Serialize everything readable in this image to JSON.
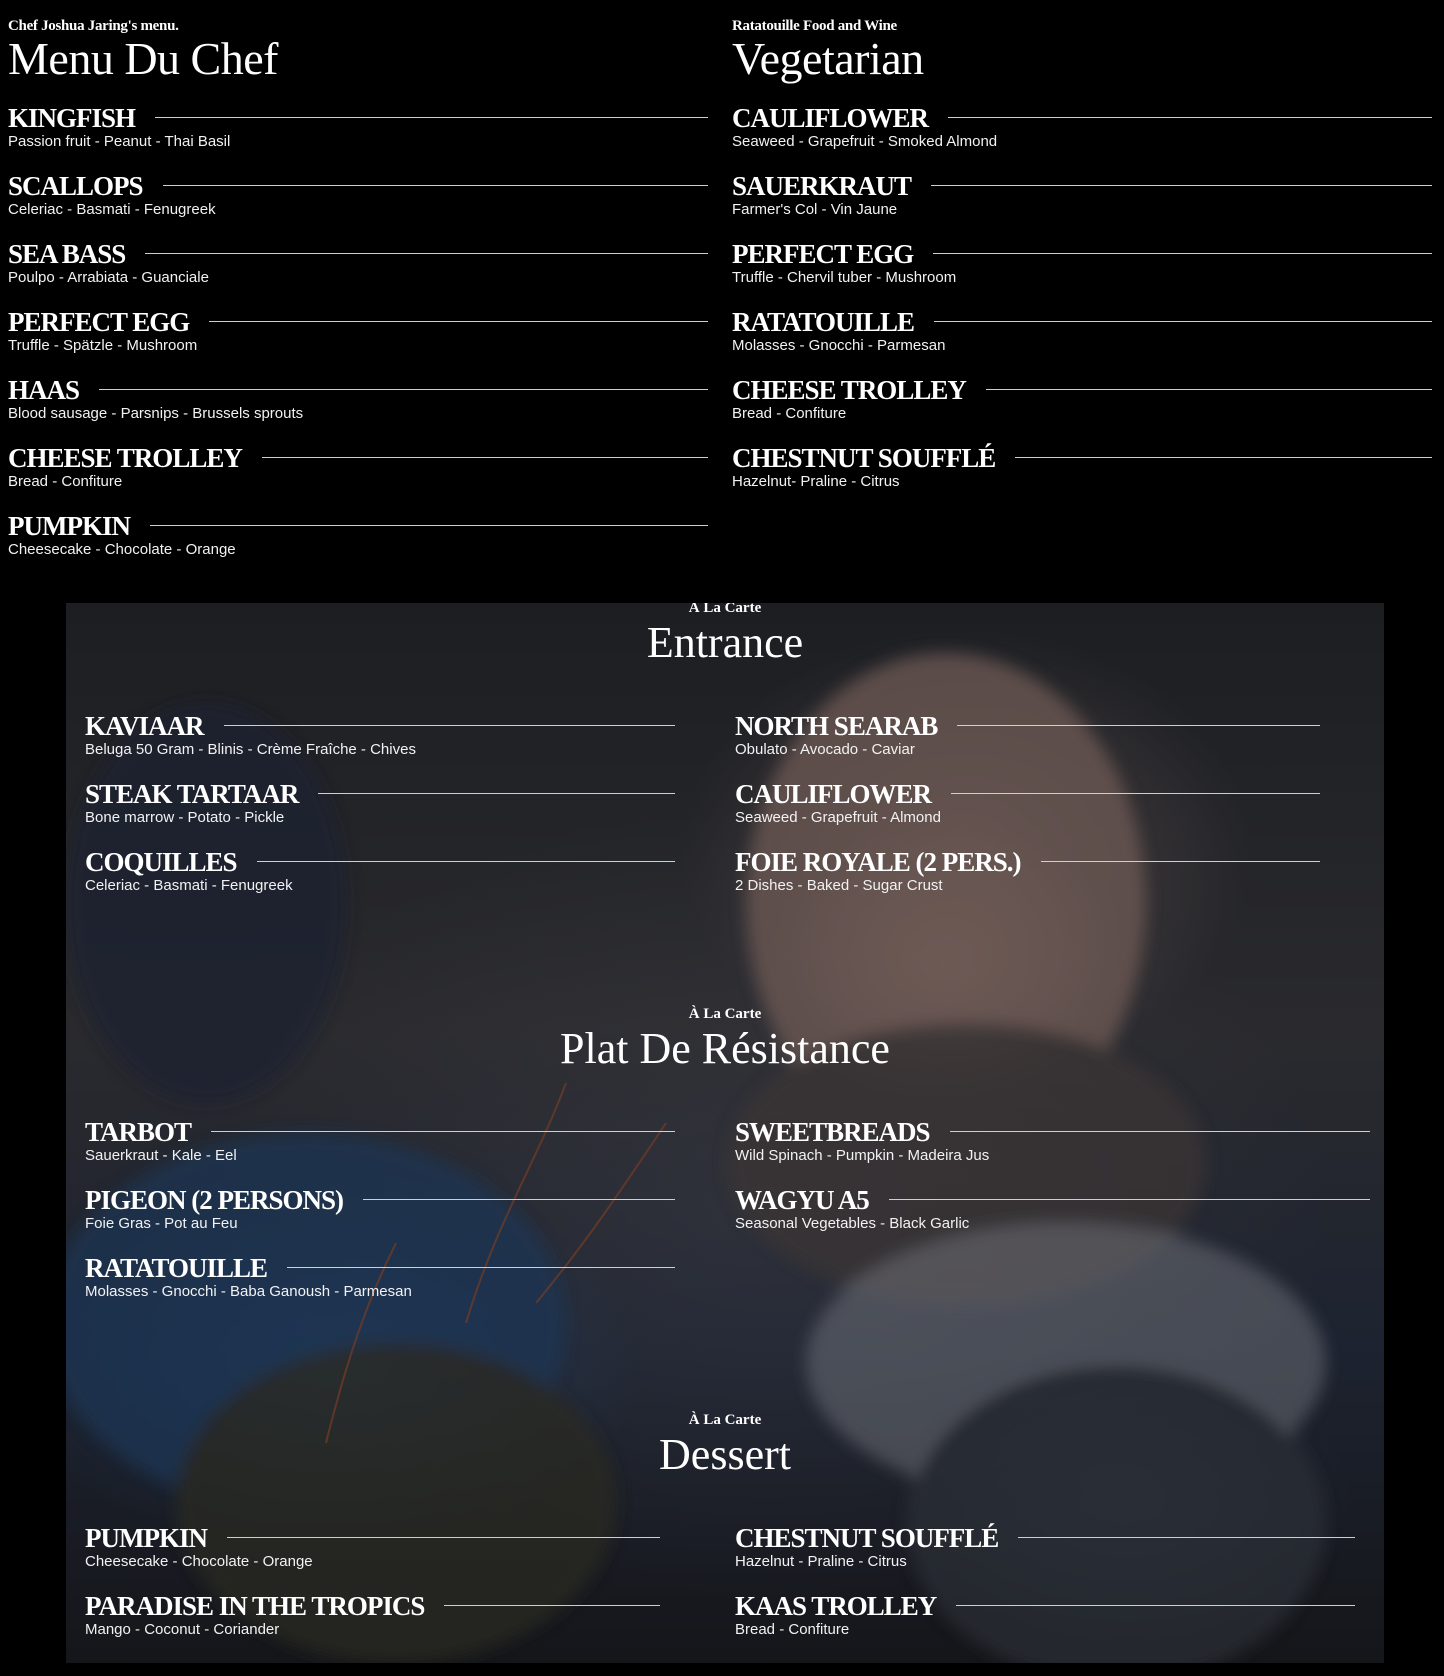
{
  "chef_menu": {
    "eyebrow": "Chef Joshua Jaring's menu.",
    "title": "Menu Du Chef",
    "items": [
      {
        "name": "KINGFISH",
        "desc": "Passion fruit - Peanut - Thai Basil"
      },
      {
        "name": "SCALLOPS",
        "desc": "Celeriac - Basmati - Fenugreek"
      },
      {
        "name": "SEA BASS",
        "desc": "Poulpo - Arrabiata - Guanciale"
      },
      {
        "name": "PERFECT EGG",
        "desc": "Truffle - Spätzle - Mushroom"
      },
      {
        "name": "HAAS",
        "desc": "Blood sausage - Parsnips - Brussels sprouts"
      },
      {
        "name": "CHEESE TROLLEY",
        "desc": "Bread - Confiture"
      },
      {
        "name": "PUMPKIN",
        "desc": "Cheesecake - Chocolate - Orange"
      }
    ]
  },
  "vegetarian_menu": {
    "eyebrow": "Ratatouille Food and Wine",
    "title": "Vegetarian",
    "items": [
      {
        "name": "CAULIFLOWER",
        "desc": "Seaweed - Grapefruit - Smoked Almond"
      },
      {
        "name": "SAUERKRAUT",
        "desc": "Farmer's Col - Vin Jaune"
      },
      {
        "name": "PERFECT EGG",
        "desc": "Truffle - Chervil tuber - Mushroom"
      },
      {
        "name": "RATATOUILLE",
        "desc": "Molasses - Gnocchi - Parmesan"
      },
      {
        "name": "CHEESE TROLLEY",
        "desc": "Bread - Confiture"
      },
      {
        "name": "CHESTNUT SOUFFLÉ",
        "desc": "Hazelnut- Praline - Citrus"
      }
    ]
  },
  "entrance": {
    "eyebrow": "À La Carte",
    "title": "Entrance",
    "left": [
      {
        "name": "KAVIAAR",
        "desc": "Beluga 50 Gram - Blinis - Crème Fraîche - Chives"
      },
      {
        "name": "STEAK TARTAAR",
        "desc": "Bone marrow - Potato - Pickle"
      },
      {
        "name": "COQUILLES",
        "desc": "Celeriac - Basmati - Fenugreek"
      }
    ],
    "right": [
      {
        "name": "NORTH SEARAB",
        "desc": "Obulato - Avocado - Caviar"
      },
      {
        "name": "CAULIFLOWER",
        "desc": "Seaweed - Grapefruit - Almond"
      },
      {
        "name": "FOIE ROYALE (2 PERS.)",
        "desc": "2 Dishes - Baked - Sugar Crust"
      }
    ]
  },
  "plat": {
    "eyebrow": "À La Carte",
    "title": "Plat De Résistance",
    "left": [
      {
        "name": "TARBOT",
        "desc": "Sauerkraut - Kale - Eel"
      },
      {
        "name": "PIGEON (2 PERSONS)",
        "desc": "Foie Gras - Pot au Feu"
      },
      {
        "name": "RATATOUILLE",
        "desc": "Molasses - Gnocchi - Baba Ganoush - Parmesan"
      }
    ],
    "right": [
      {
        "name": "SWEETBREADS",
        "desc": "Wild Spinach - Pumpkin - Madeira Jus"
      },
      {
        "name": "WAGYU A5",
        "desc": "Seasonal Vegetables - Black Garlic"
      }
    ]
  },
  "dessert": {
    "eyebrow": "À La Carte",
    "title": "Dessert",
    "left": [
      {
        "name": "PUMPKIN",
        "desc": "Cheesecake - Chocolate - Orange"
      },
      {
        "name": "PARADISE IN THE TROPICS",
        "desc": "Mango - Coconut - Coriander"
      }
    ],
    "right": [
      {
        "name": "CHESTNUT SOUFFLÉ",
        "desc": "Hazelnut - Praline - Citrus"
      },
      {
        "name": "KAAS TROLLEY",
        "desc": "Bread - Confiture"
      }
    ]
  }
}
